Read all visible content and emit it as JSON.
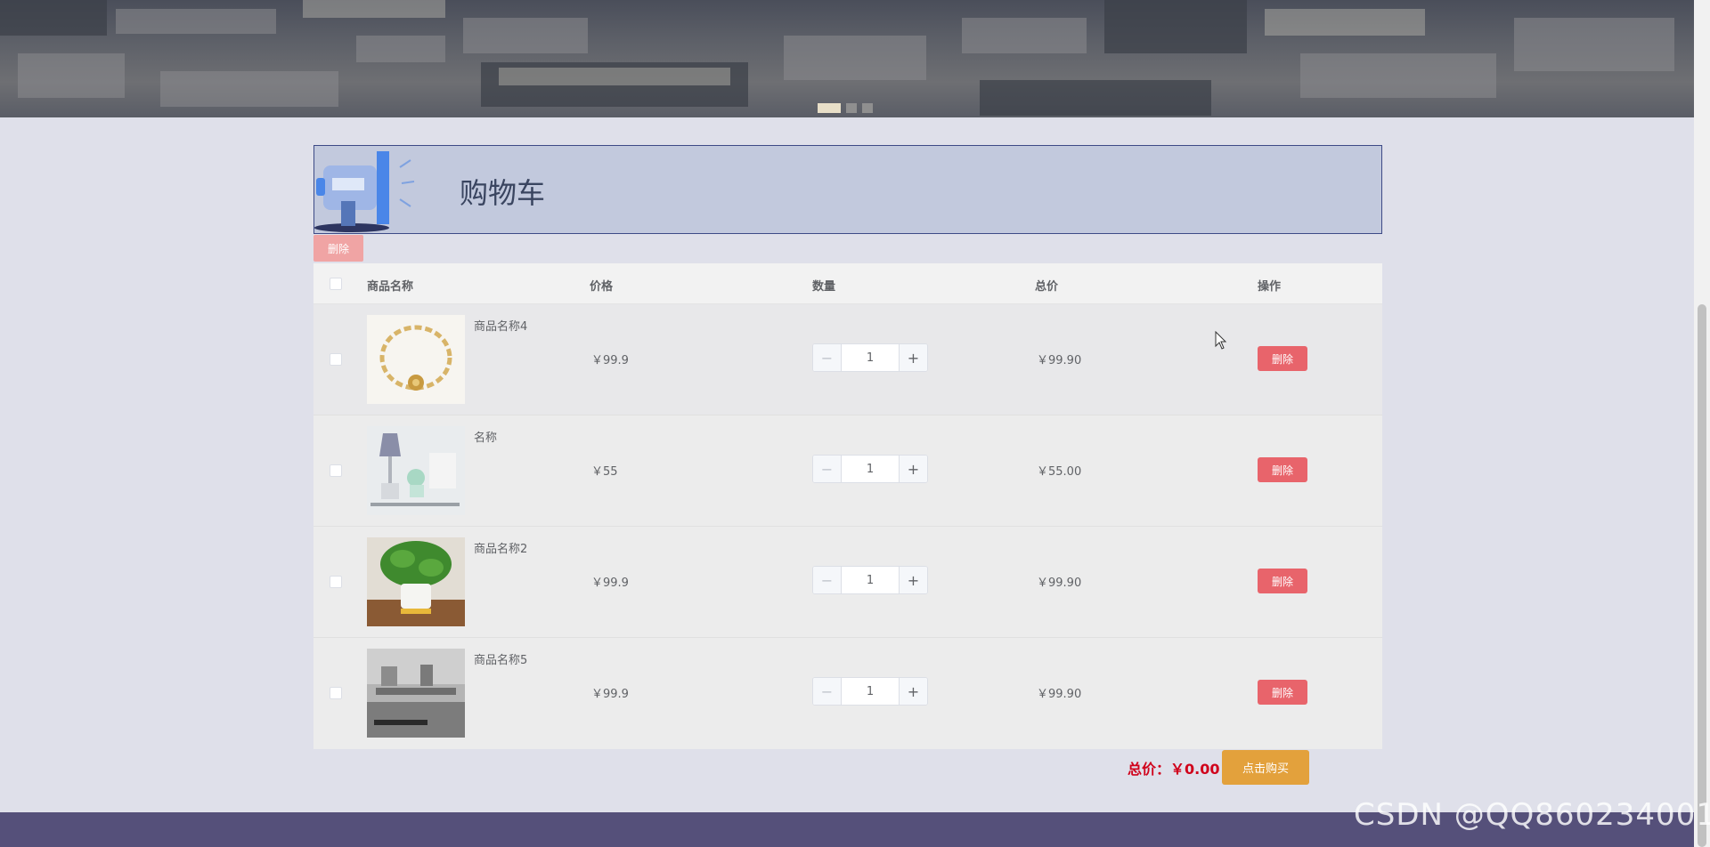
{
  "banner": {
    "slides": [
      "slide-1",
      "slide-2",
      "slide-3"
    ],
    "active_slide": 1
  },
  "cart": {
    "title": "购物车",
    "delete_selected_label": "删除",
    "columns": [
      "商品名称",
      "价格",
      "数量",
      "总价",
      "操作"
    ],
    "items": [
      {
        "name": "商品名称4",
        "price": "￥99.9",
        "quantity": "1",
        "total": "￥99.90",
        "delete_label": "删除",
        "image": "bracelet-image"
      },
      {
        "name": "名称",
        "price": "￥55",
        "quantity": "1",
        "total": "￥55.00",
        "delete_label": "删除",
        "image": "lamp-decor-image"
      },
      {
        "name": "商品名称2",
        "price": "￥99.9",
        "quantity": "1",
        "total": "￥99.90",
        "delete_label": "删除",
        "image": "potted-plant-image"
      },
      {
        "name": "商品名称5",
        "price": "￥99.9",
        "quantity": "1",
        "total": "￥99.90",
        "delete_label": "删除",
        "image": "kitchen-image"
      }
    ],
    "grand_total_label": "总价：￥0.00",
    "buy_label": "点击购买"
  },
  "watermark": "CSDN @QQ860234001",
  "colors": {
    "delete": "#e8646b",
    "buy": "#e3a13c",
    "total_text": "#d0021b",
    "header_bg": "#c2c9dd",
    "footer": "#55507a"
  }
}
